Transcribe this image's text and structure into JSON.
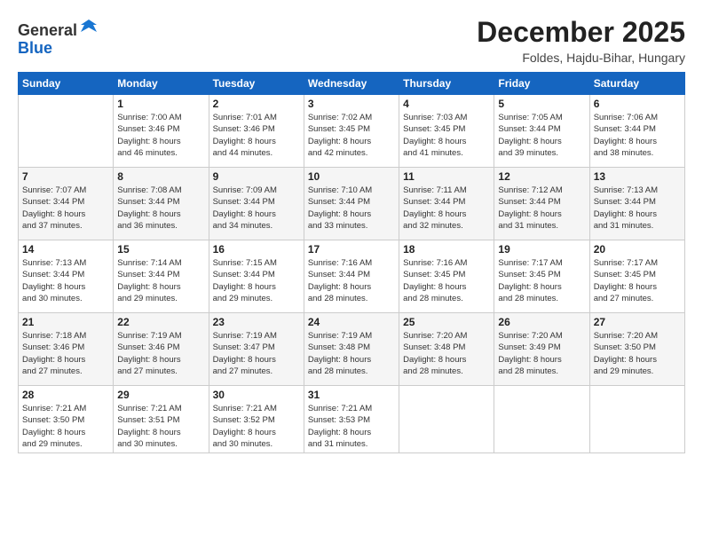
{
  "logo": {
    "general": "General",
    "blue": "Blue"
  },
  "header": {
    "month": "December 2025",
    "location": "Foldes, Hajdu-Bihar, Hungary"
  },
  "weekdays": [
    "Sunday",
    "Monday",
    "Tuesday",
    "Wednesday",
    "Thursday",
    "Friday",
    "Saturday"
  ],
  "weeks": [
    [
      {
        "day": "",
        "info": ""
      },
      {
        "day": "1",
        "info": "Sunrise: 7:00 AM\nSunset: 3:46 PM\nDaylight: 8 hours\nand 46 minutes."
      },
      {
        "day": "2",
        "info": "Sunrise: 7:01 AM\nSunset: 3:46 PM\nDaylight: 8 hours\nand 44 minutes."
      },
      {
        "day": "3",
        "info": "Sunrise: 7:02 AM\nSunset: 3:45 PM\nDaylight: 8 hours\nand 42 minutes."
      },
      {
        "day": "4",
        "info": "Sunrise: 7:03 AM\nSunset: 3:45 PM\nDaylight: 8 hours\nand 41 minutes."
      },
      {
        "day": "5",
        "info": "Sunrise: 7:05 AM\nSunset: 3:44 PM\nDaylight: 8 hours\nand 39 minutes."
      },
      {
        "day": "6",
        "info": "Sunrise: 7:06 AM\nSunset: 3:44 PM\nDaylight: 8 hours\nand 38 minutes."
      }
    ],
    [
      {
        "day": "7",
        "info": "Sunrise: 7:07 AM\nSunset: 3:44 PM\nDaylight: 8 hours\nand 37 minutes."
      },
      {
        "day": "8",
        "info": "Sunrise: 7:08 AM\nSunset: 3:44 PM\nDaylight: 8 hours\nand 36 minutes."
      },
      {
        "day": "9",
        "info": "Sunrise: 7:09 AM\nSunset: 3:44 PM\nDaylight: 8 hours\nand 34 minutes."
      },
      {
        "day": "10",
        "info": "Sunrise: 7:10 AM\nSunset: 3:44 PM\nDaylight: 8 hours\nand 33 minutes."
      },
      {
        "day": "11",
        "info": "Sunrise: 7:11 AM\nSunset: 3:44 PM\nDaylight: 8 hours\nand 32 minutes."
      },
      {
        "day": "12",
        "info": "Sunrise: 7:12 AM\nSunset: 3:44 PM\nDaylight: 8 hours\nand 31 minutes."
      },
      {
        "day": "13",
        "info": "Sunrise: 7:13 AM\nSunset: 3:44 PM\nDaylight: 8 hours\nand 31 minutes."
      }
    ],
    [
      {
        "day": "14",
        "info": "Sunrise: 7:13 AM\nSunset: 3:44 PM\nDaylight: 8 hours\nand 30 minutes."
      },
      {
        "day": "15",
        "info": "Sunrise: 7:14 AM\nSunset: 3:44 PM\nDaylight: 8 hours\nand 29 minutes."
      },
      {
        "day": "16",
        "info": "Sunrise: 7:15 AM\nSunset: 3:44 PM\nDaylight: 8 hours\nand 29 minutes."
      },
      {
        "day": "17",
        "info": "Sunrise: 7:16 AM\nSunset: 3:44 PM\nDaylight: 8 hours\nand 28 minutes."
      },
      {
        "day": "18",
        "info": "Sunrise: 7:16 AM\nSunset: 3:45 PM\nDaylight: 8 hours\nand 28 minutes."
      },
      {
        "day": "19",
        "info": "Sunrise: 7:17 AM\nSunset: 3:45 PM\nDaylight: 8 hours\nand 28 minutes."
      },
      {
        "day": "20",
        "info": "Sunrise: 7:17 AM\nSunset: 3:45 PM\nDaylight: 8 hours\nand 27 minutes."
      }
    ],
    [
      {
        "day": "21",
        "info": "Sunrise: 7:18 AM\nSunset: 3:46 PM\nDaylight: 8 hours\nand 27 minutes."
      },
      {
        "day": "22",
        "info": "Sunrise: 7:19 AM\nSunset: 3:46 PM\nDaylight: 8 hours\nand 27 minutes."
      },
      {
        "day": "23",
        "info": "Sunrise: 7:19 AM\nSunset: 3:47 PM\nDaylight: 8 hours\nand 27 minutes."
      },
      {
        "day": "24",
        "info": "Sunrise: 7:19 AM\nSunset: 3:48 PM\nDaylight: 8 hours\nand 28 minutes."
      },
      {
        "day": "25",
        "info": "Sunrise: 7:20 AM\nSunset: 3:48 PM\nDaylight: 8 hours\nand 28 minutes."
      },
      {
        "day": "26",
        "info": "Sunrise: 7:20 AM\nSunset: 3:49 PM\nDaylight: 8 hours\nand 28 minutes."
      },
      {
        "day": "27",
        "info": "Sunrise: 7:20 AM\nSunset: 3:50 PM\nDaylight: 8 hours\nand 29 minutes."
      }
    ],
    [
      {
        "day": "28",
        "info": "Sunrise: 7:21 AM\nSunset: 3:50 PM\nDaylight: 8 hours\nand 29 minutes."
      },
      {
        "day": "29",
        "info": "Sunrise: 7:21 AM\nSunset: 3:51 PM\nDaylight: 8 hours\nand 30 minutes."
      },
      {
        "day": "30",
        "info": "Sunrise: 7:21 AM\nSunset: 3:52 PM\nDaylight: 8 hours\nand 30 minutes."
      },
      {
        "day": "31",
        "info": "Sunrise: 7:21 AM\nSunset: 3:53 PM\nDaylight: 8 hours\nand 31 minutes."
      },
      {
        "day": "",
        "info": ""
      },
      {
        "day": "",
        "info": ""
      },
      {
        "day": "",
        "info": ""
      }
    ]
  ]
}
